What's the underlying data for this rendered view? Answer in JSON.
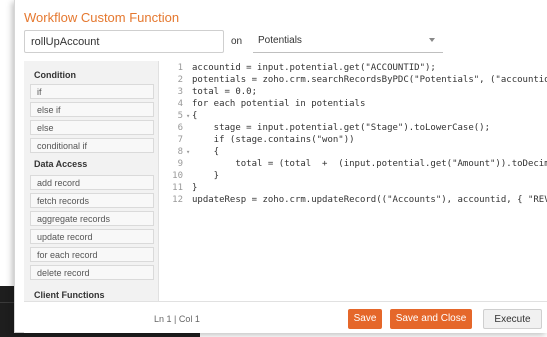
{
  "dialog": {
    "title": "Workflow Custom Function",
    "function_name": "rollUpAccount",
    "on_label": "on",
    "module": "Potentials"
  },
  "sidebar": {
    "sections": [
      {
        "heading": "Condition",
        "items": [
          "if",
          "else if",
          "else",
          "conditional if"
        ]
      },
      {
        "heading": "Data Access",
        "items": [
          "add record",
          "fetch records",
          "aggregate records",
          "update record",
          "for each record",
          "delete record"
        ]
      },
      {
        "heading": "Client Functions",
        "items": []
      }
    ]
  },
  "editor": {
    "lines": [
      {
        "num": "1",
        "fold": "",
        "text": "accountid = input.potential.get(\"ACCOUNTID\");"
      },
      {
        "num": "2",
        "fold": "",
        "text": "potentials = zoho.crm.searchRecordsByPDC(\"Potentials\", (\"accountid\"), input.accountid);"
      },
      {
        "num": "3",
        "fold": "",
        "text": "total = 0.0;"
      },
      {
        "num": "4",
        "fold": "",
        "text": "for each potential in potentials"
      },
      {
        "num": "5",
        "fold": "▾",
        "text": "{"
      },
      {
        "num": "6",
        "fold": "",
        "text": "    stage = input.potential.get(\"Stage\").toLowerCase();"
      },
      {
        "num": "7",
        "fold": "",
        "text": "    if (stage.contains(\"won\"))"
      },
      {
        "num": "8",
        "fold": "▾",
        "text": "    {"
      },
      {
        "num": "9",
        "fold": "",
        "text": "        total = (total  +  (input.potential.get(\"Amount\")).toDecimal());"
      },
      {
        "num": "10",
        "fold": "",
        "text": "    }"
      },
      {
        "num": "11",
        "fold": "",
        "text": "}"
      },
      {
        "num": "12",
        "fold": "",
        "text": "updateResp = zoho.crm.updateRecord((\"Accounts\"), accountid, { \"REVENUE\" : total });"
      }
    ]
  },
  "footer": {
    "cursor_position": "Ln 1 | Col 1",
    "save_label": "Save",
    "save_close_label": "Save and Close",
    "execute_label": "Execute"
  },
  "colors": {
    "accent": "#e5672a",
    "title": "#e5782f",
    "keyword": "#b5162e"
  }
}
